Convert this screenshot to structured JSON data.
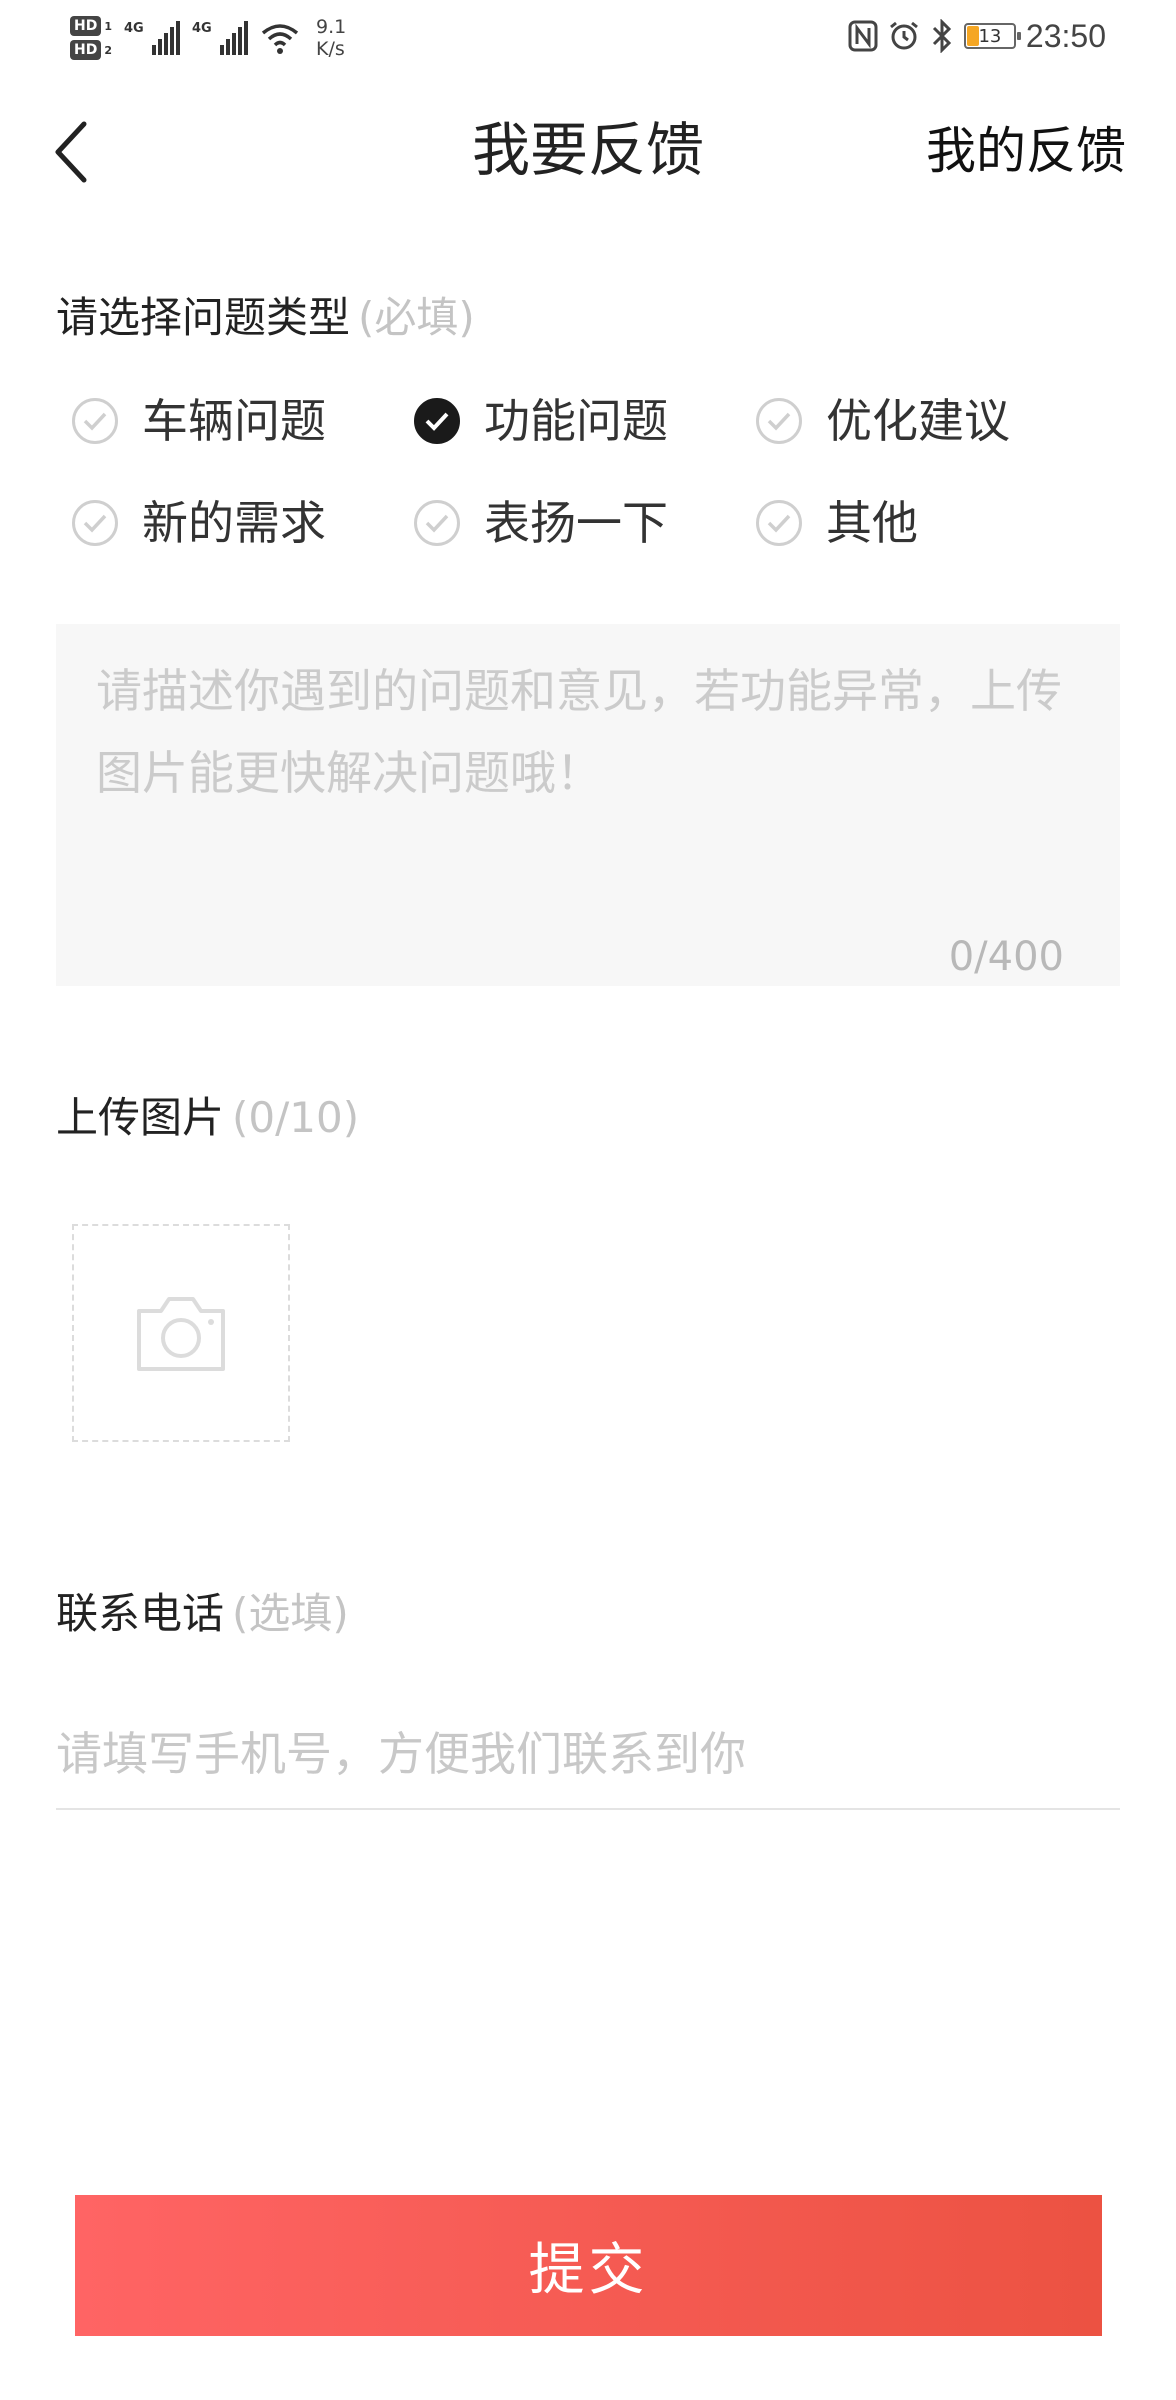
{
  "status_bar": {
    "sim1": "HD",
    "sim1_num": "1",
    "sim2": "HD",
    "sim2_num": "2",
    "network1": "4G",
    "network2": "4G",
    "speed_value": "9.1",
    "speed_unit": "K/s",
    "battery": "13",
    "time": "23:50"
  },
  "header": {
    "title": "我要反馈",
    "right_link": "我的反馈"
  },
  "problem_type": {
    "label": "请选择问题类型",
    "hint": "(必填)",
    "options": [
      {
        "label": "车辆问题",
        "selected": false
      },
      {
        "label": "功能问题",
        "selected": true
      },
      {
        "label": "优化建议",
        "selected": false
      },
      {
        "label": "新的需求",
        "selected": false
      },
      {
        "label": "表扬一下",
        "selected": false
      },
      {
        "label": "其他",
        "selected": false
      }
    ]
  },
  "description": {
    "placeholder": "请描述你遇到的问题和意见，若功能异常，上传图片能更快解决问题哦！",
    "counter": "0/400"
  },
  "upload": {
    "label": "上传图片",
    "hint": "(0/10)"
  },
  "contact": {
    "label": "联系电话",
    "hint": "(选填)",
    "placeholder": "请填写手机号，方便我们联系到你"
  },
  "submit": {
    "label": "提交"
  },
  "colors": {
    "accent_start": "#ff6464",
    "accent_end": "#ec5242",
    "hint_gray": "#c4c4c4"
  }
}
